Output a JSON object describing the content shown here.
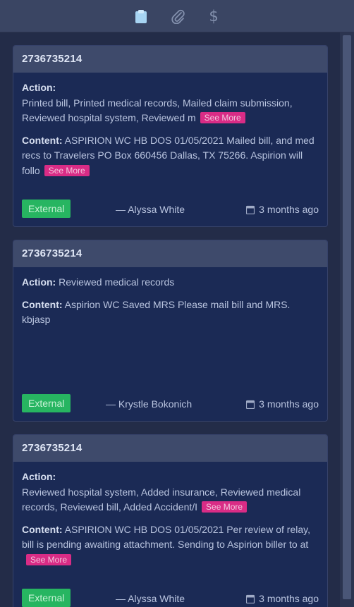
{
  "toolbar": {
    "icons": [
      "clipboard-icon",
      "paperclip-icon",
      "dollar-icon"
    ],
    "dollar_glyph": "$"
  },
  "notes": [
    {
      "id": "2736735214",
      "action_label": "Action:",
      "action_text": "Printed bill, Printed medical records, Mailed claim submission, Reviewed hospital system, Reviewed m",
      "content_label": "Content:",
      "content_text": "ASPIRION WC HB DOS 01/05/2021 Mailed bill, and med recs to Travelers PO Box 660456 Dallas, TX 75266. Aspirion will follo",
      "see_more": "See More",
      "tag": "External",
      "author": "— Alyssa White",
      "time": "3 months ago"
    },
    {
      "id": "2736735214",
      "action_label": "Action:",
      "action_text": "Reviewed medical records",
      "content_label": "Content:",
      "content_text": "Aspirion WC Saved MRS Please mail bill and MRS. kbjasp",
      "tag": "External",
      "author": "— Krystle Bokonich",
      "time": "3 months ago"
    },
    {
      "id": "2736735214",
      "action_label": "Action:",
      "action_text": "Reviewed hospital system, Added insurance, Reviewed medical records, Reviewed bill, Added Accident/I",
      "content_label": "Content:",
      "content_text": "ASPIRION WC HB DOS 01/05/2021 Per review of relay, bill is pending awaiting attachment. Sending to Aspirion biller to at",
      "see_more": "See More",
      "tag": "External",
      "author": "— Alyssa White",
      "time": "3 months ago"
    }
  ],
  "colors": {
    "background": "#1d2743",
    "card": "#1b2a55",
    "header": "#3e4a6b",
    "see_more": "#d92c86",
    "tag": "#27b561",
    "active_icon": "#a7d4f2"
  }
}
